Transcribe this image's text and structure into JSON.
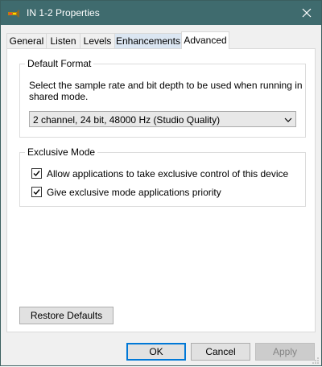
{
  "window": {
    "title": "IN 1-2 Properties",
    "title_icon": "speaker-device-icon",
    "titlebar_color": "#3f6b6e"
  },
  "tabs": [
    {
      "label": "General",
      "active": false
    },
    {
      "label": "Listen",
      "active": false
    },
    {
      "label": "Levels",
      "active": false
    },
    {
      "label": "Enhancements",
      "active": false
    },
    {
      "label": "Advanced",
      "active": true
    }
  ],
  "default_format": {
    "group_label": "Default Format",
    "description": "Select the sample rate and bit depth to be used when running in shared mode.",
    "selected_format": "2 channel, 24 bit, 48000 Hz (Studio Quality)"
  },
  "exclusive_mode": {
    "group_label": "Exclusive Mode",
    "options": [
      {
        "label": "Allow applications to take exclusive control of this device",
        "checked": true
      },
      {
        "label": "Give exclusive mode applications priority",
        "checked": true
      }
    ]
  },
  "restore_defaults_label": "Restore Defaults",
  "footer": {
    "ok_label": "OK",
    "cancel_label": "Cancel",
    "apply_label": "Apply",
    "apply_enabled": false
  }
}
